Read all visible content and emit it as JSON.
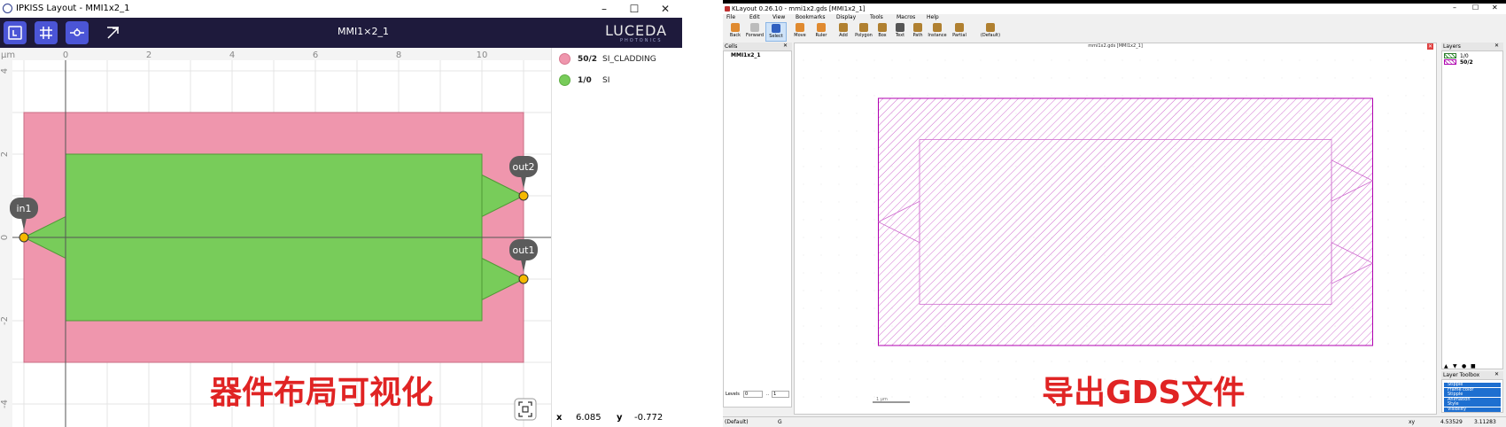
{
  "ipkiss": {
    "window_title": "IPKISS Layout - MMI1x2_1",
    "cell_title": "MMI1×2_1",
    "logo_text": "LUCEDA",
    "logo_sub": "PHOTONICS",
    "toolbar_icons": [
      "layer-toggle-icon",
      "grid-icon",
      "port-icon",
      "export-icon"
    ],
    "unit_label": "µm",
    "x_ticks": [
      "0",
      "2",
      "4",
      "6",
      "8",
      "10"
    ],
    "y_ticks": [
      "4",
      "2",
      "0",
      "-2",
      "-4"
    ],
    "ports": [
      {
        "name": "in1"
      },
      {
        "name": "out2"
      },
      {
        "name": "out1"
      }
    ],
    "layers": [
      {
        "id": "50/2",
        "name": "SI_CLADDING",
        "color": "#ef96ad"
      },
      {
        "id": "1/0",
        "name": "SI",
        "color": "#78cc5a"
      }
    ],
    "coords": {
      "x_label": "x",
      "x_value": "6.085",
      "y_label": "y",
      "y_value": "-0.772"
    },
    "caption": "器件布局可视化"
  },
  "klayout": {
    "window_title": "KLayout 0.26.10 - mmi1x2.gds [MMI1x2_1]",
    "menu": [
      "File",
      "Edit",
      "View",
      "Bookmarks",
      "Display",
      "Tools",
      "Macros",
      "Help"
    ],
    "tools": [
      "Back",
      "Forward",
      "Select",
      "Move",
      "Ruler",
      "Add",
      "Polygon",
      "Box",
      "Text",
      "Path",
      "Instance",
      "Partial",
      "(Default)"
    ],
    "cells_title": "Cells",
    "cell_name": "MMI1x2_1",
    "canvas_title": "mmi1x2.gds [MMI1x2_1]",
    "layers_title": "Layers",
    "layers": [
      "1/0",
      "50/2"
    ],
    "toolbox_title": "Layer Toolbox",
    "toolbox_items": [
      "Stipple",
      "Frame color",
      "Stipple",
      "Animation",
      "Style",
      "Visibility"
    ],
    "levels_label": "Levels",
    "levels_from": "0",
    "levels_to": "1",
    "scale_label": "1 µm",
    "status_mode": "(Default)",
    "status_g": "G",
    "status_xy_label": "xy",
    "status_x": "4.53529",
    "status_y": "3.11283",
    "accent": "#b000b0",
    "caption": "导出GDS文件"
  }
}
